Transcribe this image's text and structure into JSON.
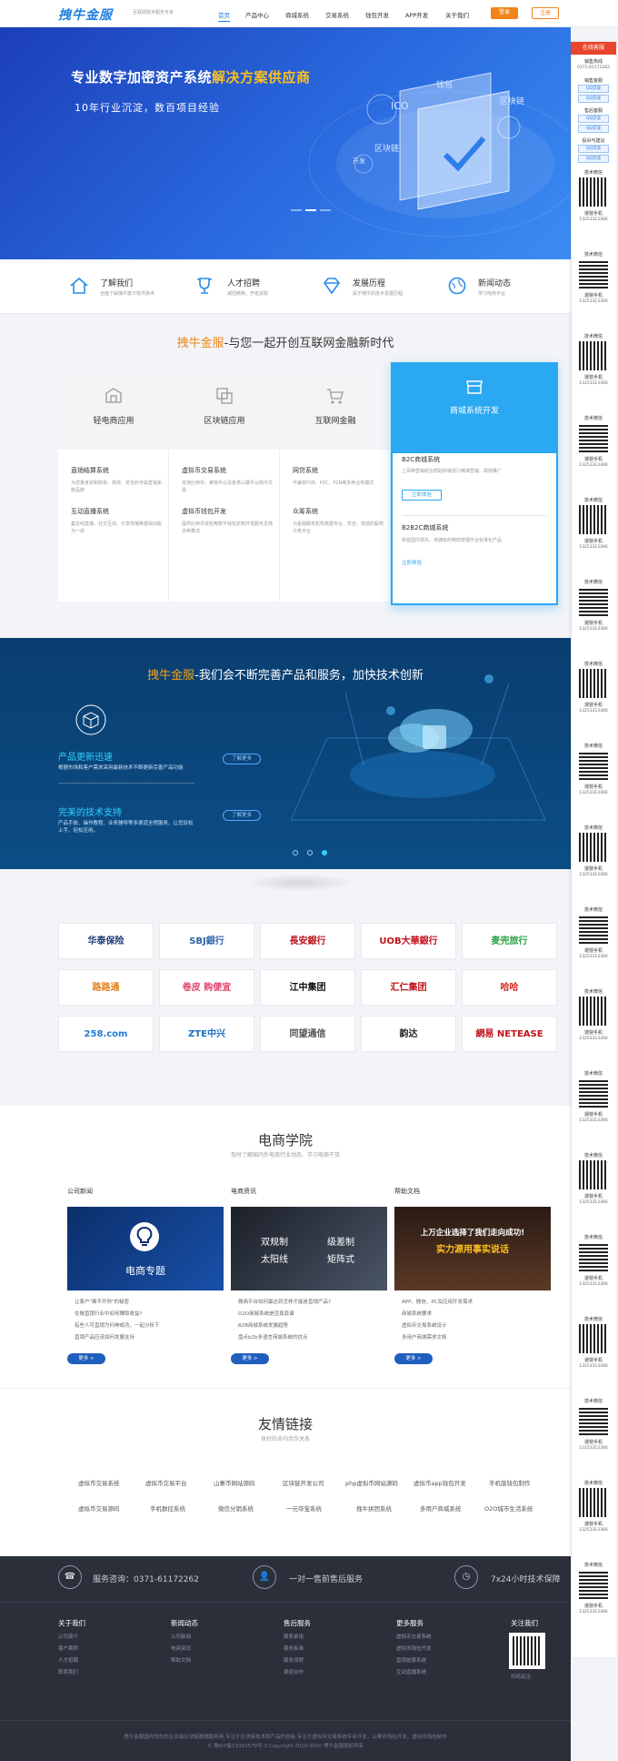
{
  "header": {
    "logo": "拽牛金服",
    "slogan": "互联网技术服务专家",
    "nav": [
      "首页",
      "产品中心",
      "商城系统",
      "交易系统",
      "钱包开发",
      "APP开发",
      "关于我们"
    ],
    "login": "登录",
    "register": "注册"
  },
  "banner": {
    "title_a": "专业数字加密资产系统",
    "title_b": "解决方案供应商",
    "subtitle": "10年行业沉淀，数百项目经验",
    "words": [
      "钱包",
      "ICO",
      "区块链",
      "区块链",
      "开发"
    ]
  },
  "features": [
    {
      "title": "了解我们",
      "desc": "全面了解拽牛旗下软件技术"
    },
    {
      "title": "人才招聘",
      "desc": "诚招精英，开拓进取"
    },
    {
      "title": "发展历程",
      "desc": "属于拽牛的技术发展历程"
    },
    {
      "title": "新闻动态",
      "desc": "学习电商平台"
    }
  ],
  "section1": {
    "title_hl": "拽牛金服",
    "title_rest": "-与您一起开创互联网金融新时代",
    "columns": [
      {
        "title": "轻电商应用",
        "items": [
          {
            "t": "直销结算系统",
            "d": "为您量身定制简单、高效、安全的专属直销系统品牌"
          },
          {
            "t": "互动直播系统",
            "d": "集在线直播、社交互动、分享传播等基础功能为一体"
          }
        ]
      },
      {
        "title": "区块链应用",
        "items": [
          {
            "t": "虚拟币交易系统",
            "d": "支持比特币、莱特币以及各类山寨币认购币交易"
          },
          {
            "t": "虚拟币钱包开发",
            "d": "提供比特币钱包等数字钱包定制开发服务支持多种算法"
          }
        ]
      },
      {
        "title": "互联网金融",
        "items": [
          {
            "t": "网贷系统",
            "d": "可兼容P2B、P2C、P2N等多种业务模式"
          },
          {
            "t": "众筹系统",
            "d": "为金融服务机构搭建专业、安全、增值的股权众筹平台"
          }
        ]
      }
    ],
    "active": {
      "title": "商城系统开发",
      "items": [
        {
          "t": "B2C商城系统",
          "d": "上百种营销组合帮助商城进行精准营销、高效推广",
          "btn": "立即体验"
        },
        {
          "t": "B2B2C商城系统",
          "d": "新能国内领先，将拥有的电商管理平台标准化产品",
          "btn": "立即体验"
        }
      ]
    }
  },
  "section2": {
    "title_hl": "拽牛金服",
    "title_rest": "-我们会不断完善产品和服务，加快技术创新",
    "blocks": [
      {
        "h": "产品更新迅速",
        "d": "根据市场和客户需求采用最新技术不断更新完善产品功能",
        "more": "了解更多"
      },
      {
        "h": "完美的技术支持",
        "d": "产品手册、操作教程、业务辅导等多渠道全程服务、让您轻松上手、轻松应用。",
        "more": "了解更多"
      }
    ]
  },
  "partners": [
    [
      "华泰保险",
      "SBJ銀行",
      "長安銀行",
      "UOB大華銀行",
      "麦兜旅行"
    ],
    [
      "路路通",
      "卷皮 购便宜",
      "江中集团",
      "汇仁集团",
      "哈哈"
    ],
    [
      "258.com",
      "ZTE中兴",
      "同望通信",
      "韵达",
      "網易 NETEASE"
    ]
  ],
  "academy": {
    "title": "电商学院",
    "subtitle": "及时了解国内外电商行业动态、学习电商干货",
    "cols": [
      {
        "head": "公司新闻",
        "img": "电商专题",
        "items": [
          "让客户\"离不开你\"的秘密",
          "在做直销行业中如何赚取收益?",
          "有些人可直销为何伸成功，一起分析下",
          "直销产品应该如何发展支持"
        ],
        "more": "更多 >"
      },
      {
        "head": "电商资讯",
        "img_a": "双规制",
        "img_b": "级差制",
        "img_c": "太阳线",
        "img_d": "矩阵式",
        "items": [
          "微商平台如何赢达到怎样才能是直销产品?",
          "O2O商城系统是否真靠谱",
          "B2B商城系统发展趋势",
          "盘点b2b多语言商城系统的优点"
        ],
        "more": "更多 >"
      },
      {
        "head": "帮助文档",
        "img_a": "上万企业选择了我们走向成功!",
        "img_b": "实力源用事实说话",
        "items": [
          "APP、微信、PC及应用开发需求",
          "商城系统要求",
          "虚拟币交易系统设计",
          "多用户商城需求文档"
        ],
        "more": "更多 >"
      }
    ]
  },
  "links": {
    "title": "友情链接",
    "subtitle": "良好的业内合作关系",
    "row1": [
      "虚拟币交易系统",
      "虚拟币交易平台",
      "山寨币网站源码",
      "区块链开发公司",
      "php虚拟币网站源码",
      "虚拟币app钱包开发",
      "手机版钱包制作"
    ],
    "row2": [
      "虚拟币交易源码",
      "手机群控系统",
      "微信分销系统",
      "一元夺宝系统",
      "拽牛拼团系统",
      "多用户商城系统",
      "O2O城市生活系统"
    ]
  },
  "footer": {
    "services": [
      "服务咨询：0371-61172262",
      "一对一售前售后服务",
      "7x24小时技术保障"
    ],
    "cols": [
      {
        "h": "关于我们",
        "items": [
          "公司简介",
          "客户案例",
          "人才招聘",
          "联系我们"
        ]
      },
      {
        "h": "新闻动态",
        "items": [
          "公司新闻",
          "电商资讯",
          "帮助文档"
        ]
      },
      {
        "h": "售后服务",
        "items": [
          "服务承诺",
          "服务标准",
          "服务流程",
          "渠道合作"
        ]
      },
      {
        "h": "更多服务",
        "items": [
          "虚拟币交易系统",
          "虚拟币钱包开发",
          "直销结算系统",
          "互动直播系统"
        ]
      },
      {
        "h": "关注我们",
        "items": [
          "扫码关注"
        ]
      }
    ],
    "copy1": "拽牛金服国内领先的企业级区块链数据服务商,专注于区块链技术和产品的创新,专注于虚拟币交易系统平台开发，山寨币钱包开发，虚拟币钱包制作",
    "copy2": "© 豫ICP备11002579号-3 Copyright 2010-2020 拽牛金服版权所有"
  },
  "side": {
    "head": "在线客服",
    "hotline_t": "销售热线",
    "hotline": "0371-61172262",
    "groups": [
      "销售客服",
      "售后客服",
      "投诉与建议"
    ],
    "qq": "QQ交谈",
    "tech": "技术微信",
    "mgr": "運營手机",
    "mgr_phone": "13253313366"
  },
  "colors": {
    "brand": "#1e7fe0",
    "accent": "#f08519",
    "active": "#2aa8f2"
  }
}
